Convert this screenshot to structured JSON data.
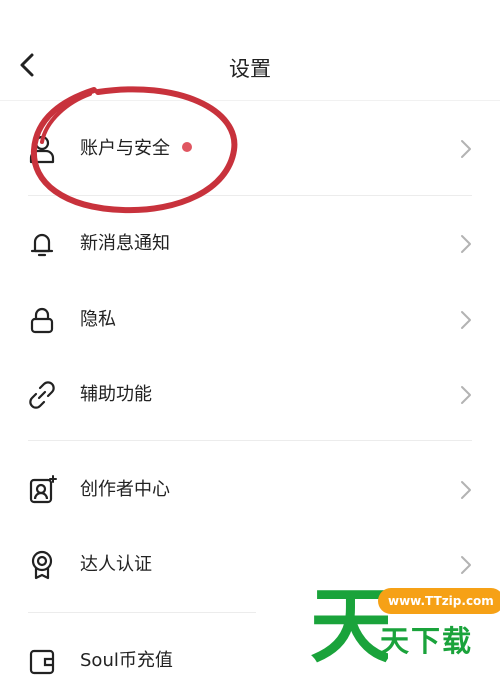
{
  "header": {
    "title": "设置"
  },
  "menu": [
    {
      "label": "账户与安全",
      "icon": "user-icon",
      "has_dot": true,
      "dot_color": "#e05661"
    },
    {
      "label": "新消息通知",
      "icon": "bell-icon"
    },
    {
      "label": "隐私",
      "icon": "lock-icon"
    },
    {
      "label": "辅助功能",
      "icon": "link-icon"
    },
    {
      "label": "创作者中心",
      "icon": "creator-icon"
    },
    {
      "label": "达人认证",
      "icon": "badge-icon"
    },
    {
      "label": "Soul币充值",
      "icon": "wallet-icon"
    }
  ],
  "annotation": {
    "color": "#c8323c"
  },
  "watermark": {
    "url": "www.TTzip.com",
    "brand_glyph": "天",
    "brand_text": "天下载",
    "color": "#1aa33b",
    "accent": "#f6a116"
  }
}
